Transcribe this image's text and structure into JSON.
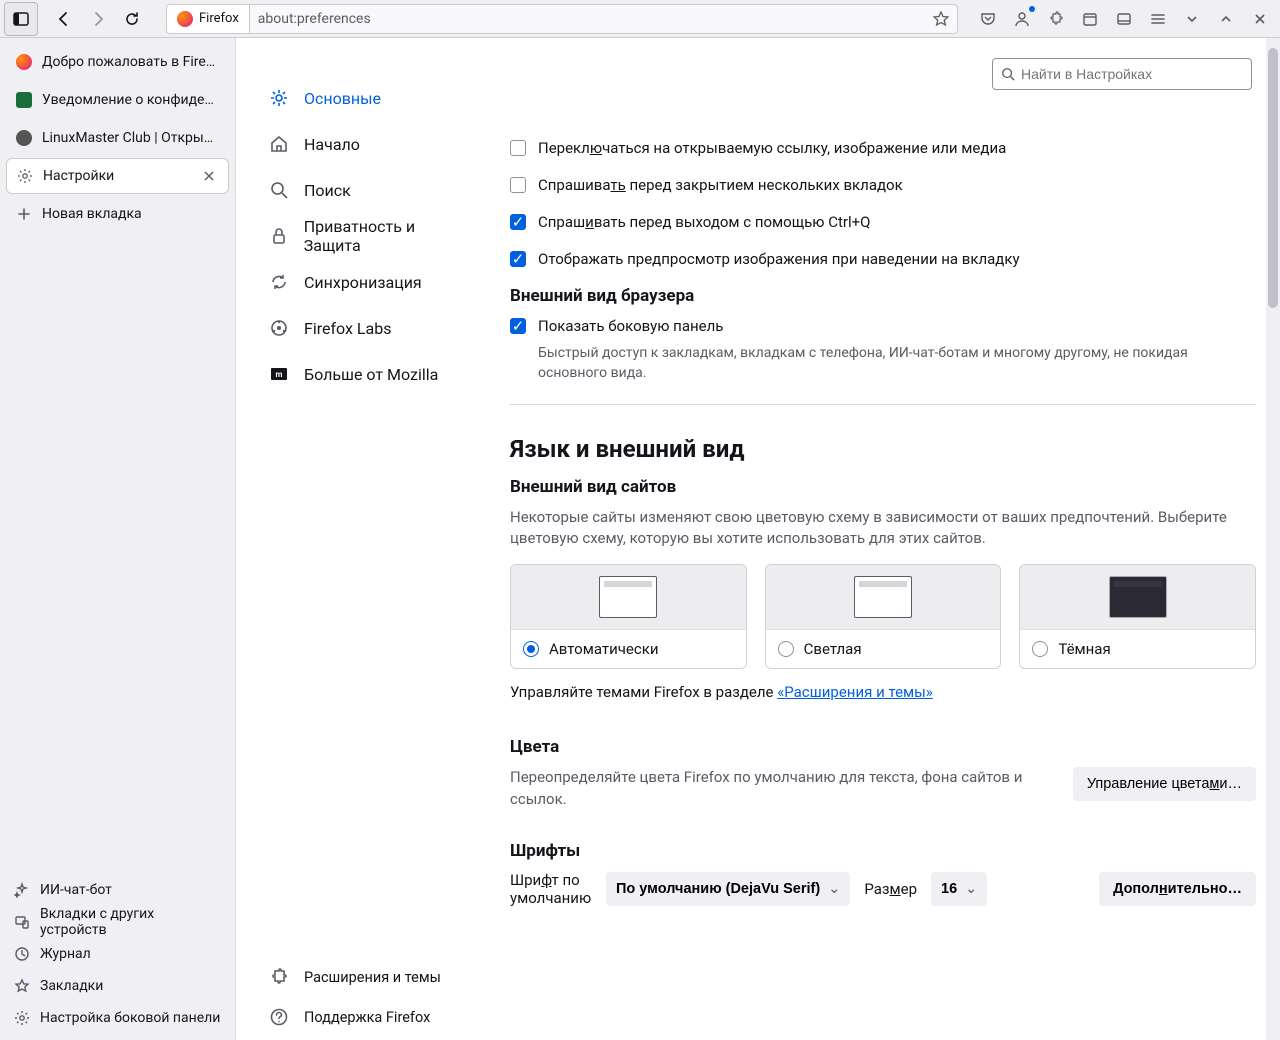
{
  "identity": {
    "app": "Firefox",
    "url": "about:preferences"
  },
  "search": {
    "placeholder": "Найти в Настройках"
  },
  "tabs": [
    {
      "label": "Добро пожаловать в Firefox",
      "favicon": "firefox"
    },
    {
      "label": "Уведомление о конфиденц",
      "favicon": "green"
    },
    {
      "label": "LinuxMaster Club | Открыты",
      "favicon": "gray"
    },
    {
      "label": "Настройки",
      "favicon": "gear",
      "active": true
    },
    {
      "label": "Новая вкладка",
      "favicon": "plus"
    }
  ],
  "sideTools": [
    {
      "label": "ИИ-чат-бот",
      "icon": "sparkle"
    },
    {
      "label": "Вкладки с других устройств",
      "icon": "devices"
    },
    {
      "label": "Журнал",
      "icon": "clock"
    },
    {
      "label": "Закладки",
      "icon": "star"
    },
    {
      "label": "Настройка боковой панели",
      "icon": "gear"
    }
  ],
  "prefsNav": [
    {
      "label": "Основные",
      "icon": "gear",
      "selected": true
    },
    {
      "label": "Начало",
      "icon": "home"
    },
    {
      "label": "Поиск",
      "icon": "search"
    },
    {
      "label": "Приватность и Защита",
      "icon": "lock"
    },
    {
      "label": "Синхронизация",
      "icon": "sync"
    },
    {
      "label": "Firefox Labs",
      "icon": "flask"
    },
    {
      "label": "Больше от Mozilla",
      "icon": "mozilla"
    }
  ],
  "prefsNavBottom": [
    {
      "label": "Расширения и темы",
      "icon": "puzzle"
    },
    {
      "label": "Поддержка Firefox",
      "icon": "help"
    }
  ],
  "checkboxes": {
    "switch_to_link": {
      "label_pre": "Перекл",
      "label_u": "ю",
      "label_post": "чаться на открываемую ссылку, изображение или медиа",
      "checked": false
    },
    "ask_close_multi": {
      "label_pre": "Спрашива",
      "label_u": "ть",
      "label_post": " перед закрытием нескольких вкладок",
      "checked": false
    },
    "ask_quit_ctrlq": {
      "label_pre": "Спраш",
      "label_u": "и",
      "label_post": "вать перед выходом с помощью Ctrl+Q",
      "checked": true
    },
    "preview_hover": {
      "label": "Отображать предпросмотр изображения при наведении на вкладку",
      "checked": true
    }
  },
  "appearance": {
    "group_title": "Внешний вид браузера",
    "show_sidebar": {
      "label": "Показать боковую панель",
      "checked": true,
      "desc": "Быстрый доступ к закладкам, вкладкам с телефона, ИИ-чат-ботам и многому другому, не покидая основного вида."
    }
  },
  "lang_section_title": "Язык и внешний вид",
  "site_appearance": {
    "title": "Внешний вид сайтов",
    "desc": "Некоторые сайты изменяют свою цветовую схему в зависимости от ваших предпочтений. Выберите цветовую схему, которую вы хотите использовать для этих сайтов.",
    "options": [
      {
        "label": "Автоматически",
        "checked": true,
        "variant": "auto"
      },
      {
        "label": "Светлая",
        "checked": false,
        "variant": "light"
      },
      {
        "label": "Тёмная",
        "checked": false,
        "variant": "dark"
      }
    ],
    "link_pre": "Управляйте темами Firefox в разделе ",
    "link_text": "«Расширения и темы»"
  },
  "colors": {
    "title": "Цвета",
    "desc": "Переопределяйте цвета Firefox по умолчанию для текста, фона сайтов и ссылок.",
    "button_pre": "Управление цвета",
    "button_u": "м",
    "button_post": "и…"
  },
  "fonts": {
    "title": "Шрифты",
    "label_pre": "Шри",
    "label_u": "ф",
    "label_post": "т по умолчанию",
    "default_font": "По умолчанию (DejaVu Serif)",
    "size_label_pre": "Раз",
    "size_label_u": "м",
    "size_label_post": "ер",
    "size_value": "16",
    "advanced_pre": "Допол",
    "advanced_u": "н",
    "advanced_post": "ительно…"
  }
}
